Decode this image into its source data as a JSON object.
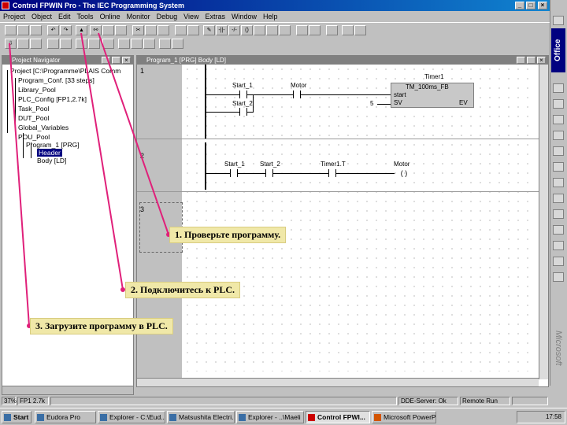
{
  "window": {
    "title": "Control FPWIN Pro - The IEC Programming System",
    "controls": [
      "_",
      "□",
      "×"
    ]
  },
  "menu": [
    "Project",
    "Object",
    "Edit",
    "Tools",
    "Online",
    "Monitor",
    "Debug",
    "View",
    "Extras",
    "Window",
    "Help"
  ],
  "office_bar": {
    "label": "Office",
    "brand": "Microsoft"
  },
  "navigator": {
    "title": "Project Navigator",
    "items": [
      "Project [C:\\Programme\\PLAIS Comm",
      "Program_Conf. [33 steps]",
      "Library_Pool",
      "PLC_Config [FP1,2.7k]",
      "Task_Pool",
      "DUT_Pool",
      "Global_Variables",
      "POU_Pool",
      "Program_1 [PRG]",
      "Header",
      "Body [LD]"
    ]
  },
  "editor": {
    "title": "Program_1 [PRG] Body [LD]",
    "networks": [
      "1",
      "2",
      "3"
    ],
    "rung1": {
      "contact1": "Start_1",
      "contact2": "Start_2",
      "coil_contact": "Motor",
      "constant": "5",
      "fb_instance": "Timer1",
      "fb_type": "TM_100ms_FB",
      "fb_in1": "start",
      "fb_in2": "SV",
      "fb_out": "EV"
    },
    "rung2": {
      "contact1": "Start_1",
      "contact2": "Start_2",
      "contact3": "Timer1.T",
      "coil": "Motor"
    }
  },
  "callouts": {
    "c1": "1. Проверьте программу.",
    "c2": "2. Подключитесь к PLC.",
    "c3": "3. Загрузите программу в PLC."
  },
  "status": {
    "zoom": "37%",
    "plc": "FP1 2.7k",
    "server": "DDE-Server: Ok",
    "mode": "Remote Run"
  },
  "taskbar": {
    "start": "Start",
    "buttons": [
      "Eudora Pro",
      "Explorer - C:\\Eud...",
      "Matsushita Electri...",
      "Explorer - ..\\Maeli",
      "Control FPWI...",
      "Microsoft PowerP..."
    ],
    "clock": "17:58"
  },
  "colors": {
    "titlebar": "#000080",
    "callout_bg": "#f0e8a8",
    "arrow": "#e0207a"
  }
}
